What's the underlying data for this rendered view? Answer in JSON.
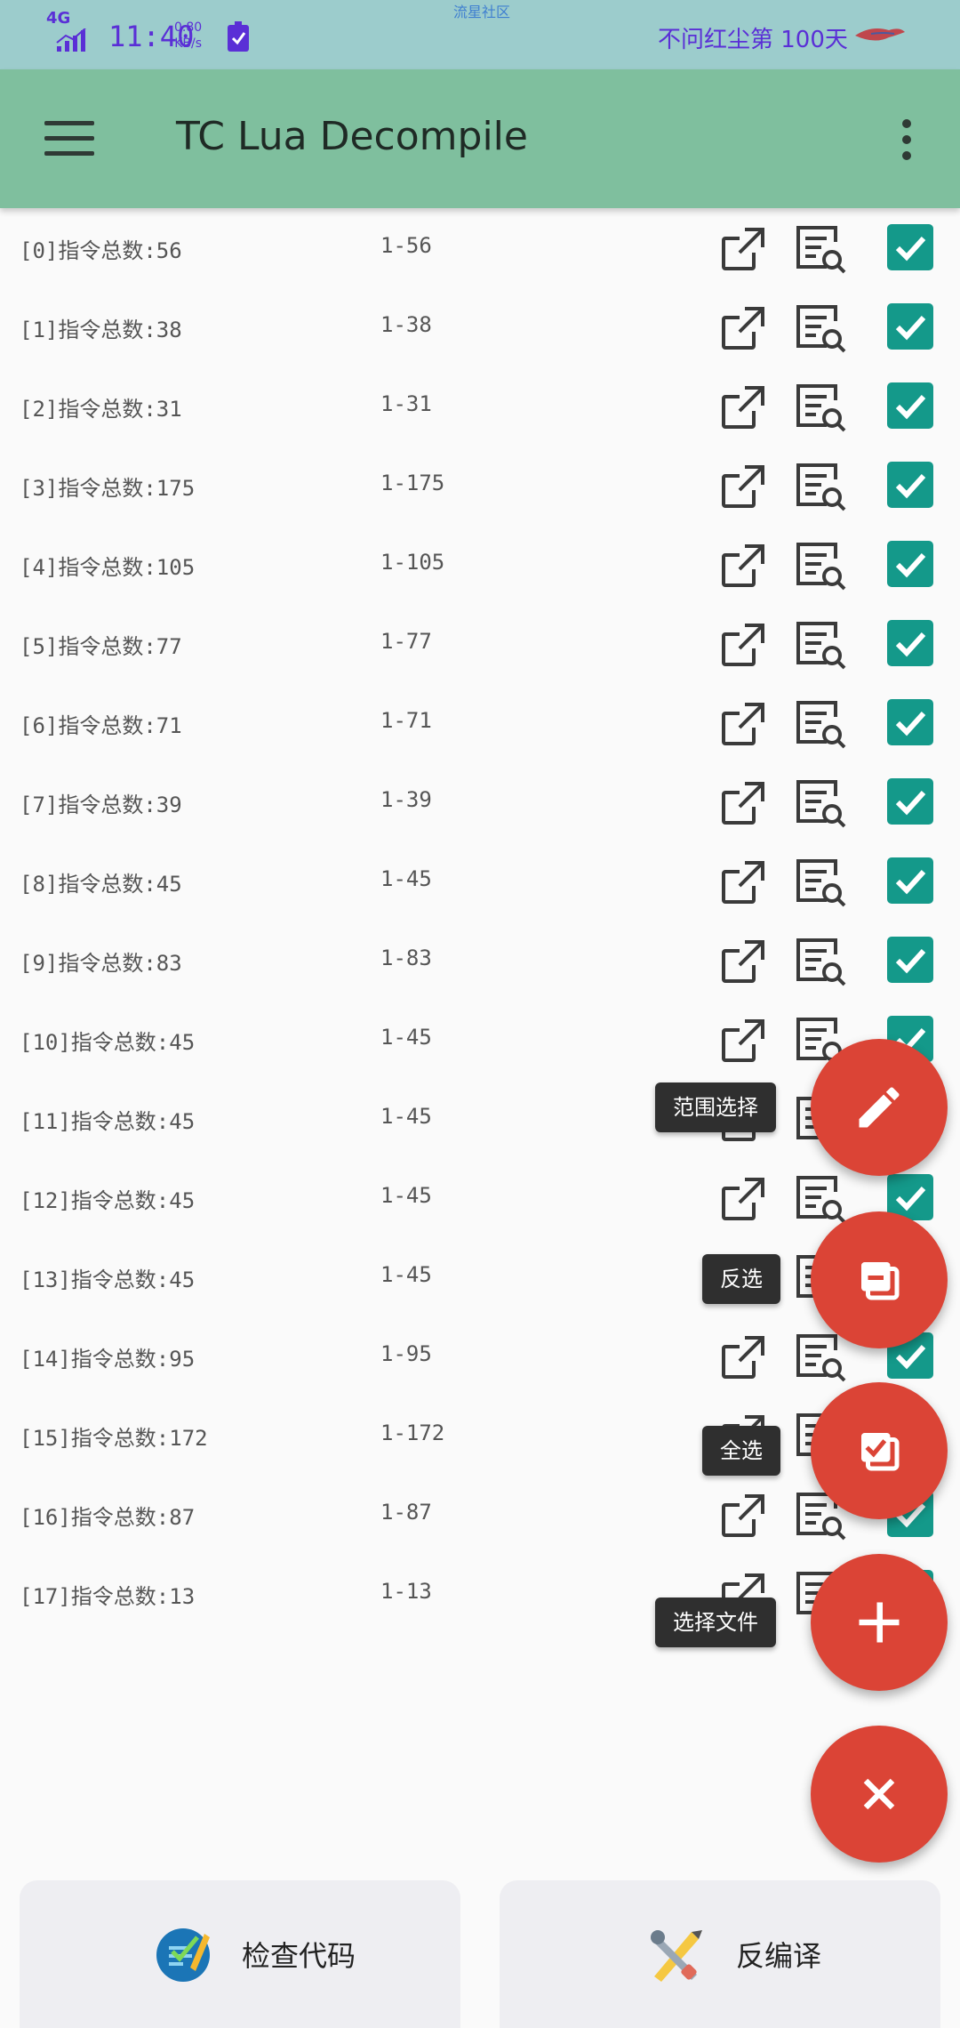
{
  "status_bar": {
    "network": "4G",
    "time": "11:40",
    "speed_value": "0.80",
    "speed_unit": "KB/s",
    "community": "流星社区",
    "tagline": "不问红尘第 100天"
  },
  "app_bar": {
    "title": "TC Lua Decompile"
  },
  "list": [
    {
      "label": "[0]指令总数:56",
      "range": "1-56"
    },
    {
      "label": "[1]指令总数:38",
      "range": "1-38"
    },
    {
      "label": "[2]指令总数:31",
      "range": "1-31"
    },
    {
      "label": "[3]指令总数:175",
      "range": "1-175"
    },
    {
      "label": "[4]指令总数:105",
      "range": "1-105"
    },
    {
      "label": "[5]指令总数:77",
      "range": "1-77"
    },
    {
      "label": "[6]指令总数:71",
      "range": "1-71"
    },
    {
      "label": "[7]指令总数:39",
      "range": "1-39"
    },
    {
      "label": "[8]指令总数:45",
      "range": "1-45"
    },
    {
      "label": "[9]指令总数:83",
      "range": "1-83"
    },
    {
      "label": "[10]指令总数:45",
      "range": "1-45"
    },
    {
      "label": "[11]指令总数:45",
      "range": "1-45"
    },
    {
      "label": "[12]指令总数:45",
      "range": "1-45"
    },
    {
      "label": "[13]指令总数:45",
      "range": "1-45"
    },
    {
      "label": "[14]指令总数:95",
      "range": "1-95"
    },
    {
      "label": "[15]指令总数:172",
      "range": "1-172"
    },
    {
      "label": "[16]指令总数:87",
      "range": "1-87"
    },
    {
      "label": "[17]指令总数:13",
      "range": "1-13"
    }
  ],
  "fab_menu": {
    "range_select": "范围选择",
    "invert_select": "反选",
    "select_all": "全选",
    "select_file": "选择文件"
  },
  "bottom": {
    "check_code": "检查代码",
    "decompile": "反编译"
  },
  "colors": {
    "status_bar": "#9ccccc",
    "app_bar": "#7fbf9e",
    "checkbox": "#14998a",
    "fab": "#db4436"
  }
}
